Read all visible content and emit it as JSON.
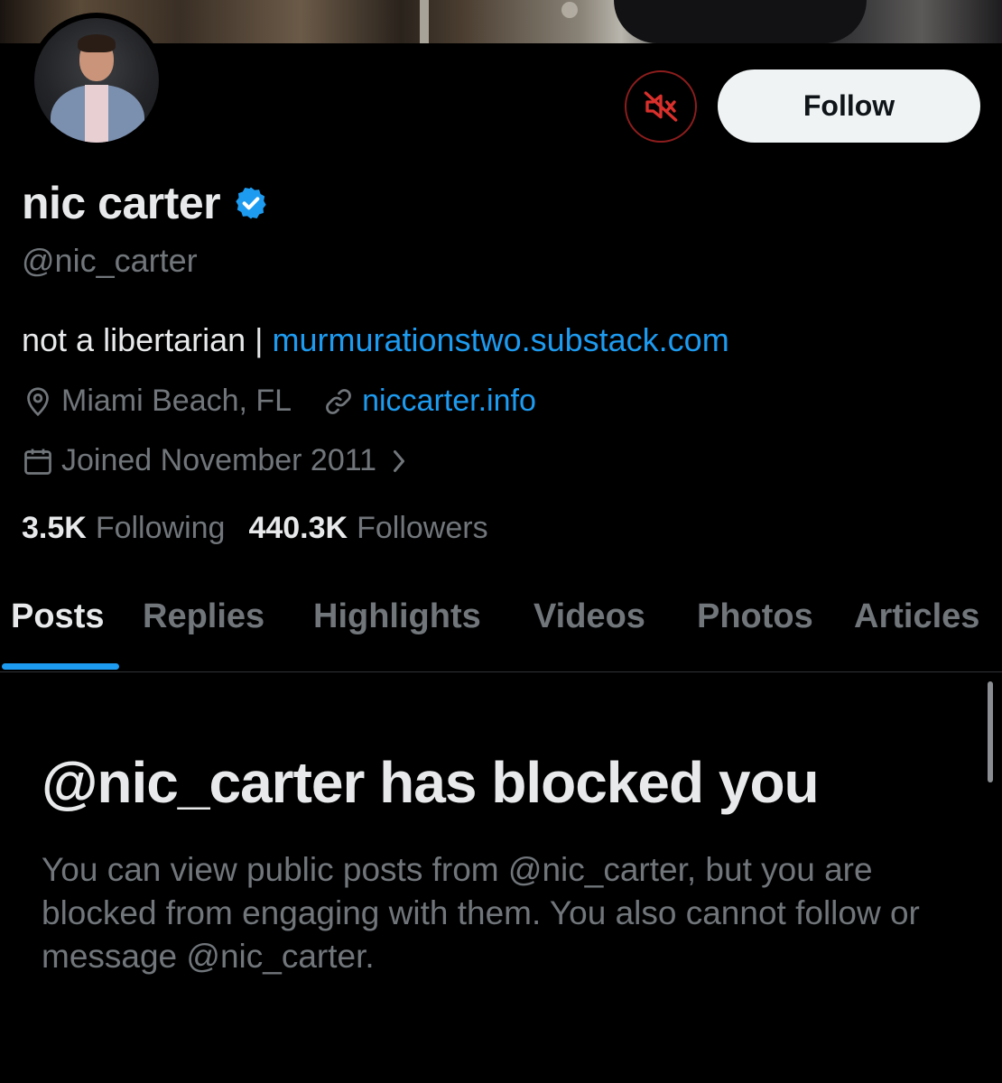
{
  "profile": {
    "name": "nic carter",
    "handle": "@nic_carter",
    "bio_text": "not a libertarian | ",
    "bio_link": "murmurationstwo.substack.com",
    "location": "Miami Beach, FL",
    "website": "niccarter.info",
    "joined": "Joined November 2011",
    "following_count": "3.5K",
    "following_label": "Following",
    "followers_count": "440.3K",
    "followers_label": "Followers"
  },
  "actions": {
    "follow_label": "Follow",
    "mute_icon": "muted-speaker-icon"
  },
  "tabs": [
    {
      "label": "Posts",
      "active": true
    },
    {
      "label": "Replies",
      "active": false
    },
    {
      "label": "Highlights",
      "active": false
    },
    {
      "label": "Videos",
      "active": false
    },
    {
      "label": "Photos",
      "active": false
    },
    {
      "label": "Articles",
      "active": false
    }
  ],
  "blocked": {
    "title": "@nic_carter has blocked you",
    "message": "You can view public posts from @nic_carter, but you are blocked from engaging with them. You also cannot follow or message @nic_carter."
  },
  "colors": {
    "background": "#000000",
    "accent": "#1d9bf0",
    "secondary_text": "#71767b",
    "mute_border": "#8e1d1d",
    "mute_icon": "#d9302c"
  }
}
